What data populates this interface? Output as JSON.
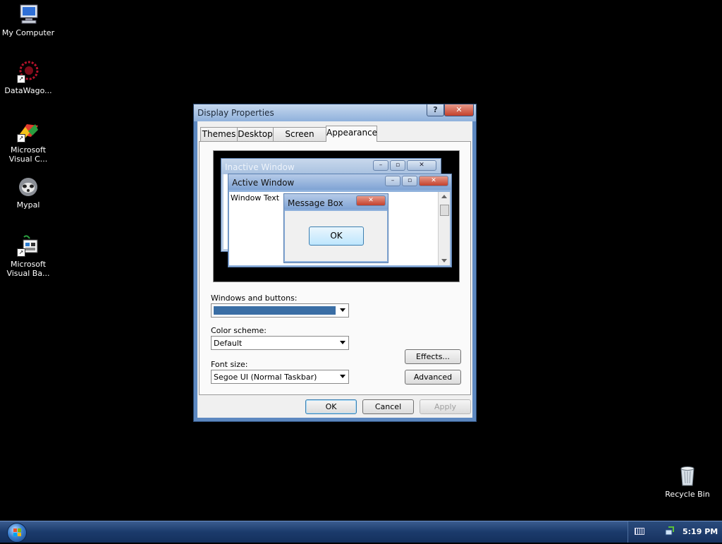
{
  "desktop": {
    "icons": [
      {
        "label": "My Computer",
        "icon": "computer-icon"
      },
      {
        "label": "DataWago...",
        "icon": "datawagon-icon"
      },
      {
        "label": "Microsoft Visual C...",
        "icon": "visual-c-icon"
      },
      {
        "label": "Mypal",
        "icon": "mypal-icon"
      },
      {
        "label": "Microsoft Visual Ba...",
        "icon": "visual-basic-icon"
      },
      {
        "label": "Recycle Bin",
        "icon": "recycle-bin-icon"
      }
    ]
  },
  "dialog": {
    "title": "Display Properties",
    "help_glyph": "?",
    "close_glyph": "✕",
    "tabs": [
      {
        "label": "Themes"
      },
      {
        "label": "Desktop"
      },
      {
        "label": "Screen Saver"
      },
      {
        "label": "Appearance",
        "active": true
      }
    ],
    "preview": {
      "inactive_title": "Inactive Window",
      "active_title": "Active Window",
      "window_text": "Window Text",
      "message_box_title": "Message Box",
      "message_box_ok": "OK"
    },
    "windows_buttons_label": "Windows and buttons:",
    "windows_buttons_value": "",
    "color_scheme_label": "Color scheme:",
    "color_scheme_value": "Default",
    "font_size_label": "Font size:",
    "font_size_value": "Segoe UI (Normal Taskbar)",
    "effects_label": "Effects...",
    "advanced_label": "Advanced",
    "ok_label": "OK",
    "cancel_label": "Cancel",
    "apply_label": "Apply"
  },
  "taskbar": {
    "clock": "5:19 PM",
    "tray_icons": [
      "keyboard-icon",
      "network-icon"
    ]
  },
  "colors": {
    "selected_scheme_swatch": "#3a6ea5",
    "title_blue": "#5d88c0"
  }
}
